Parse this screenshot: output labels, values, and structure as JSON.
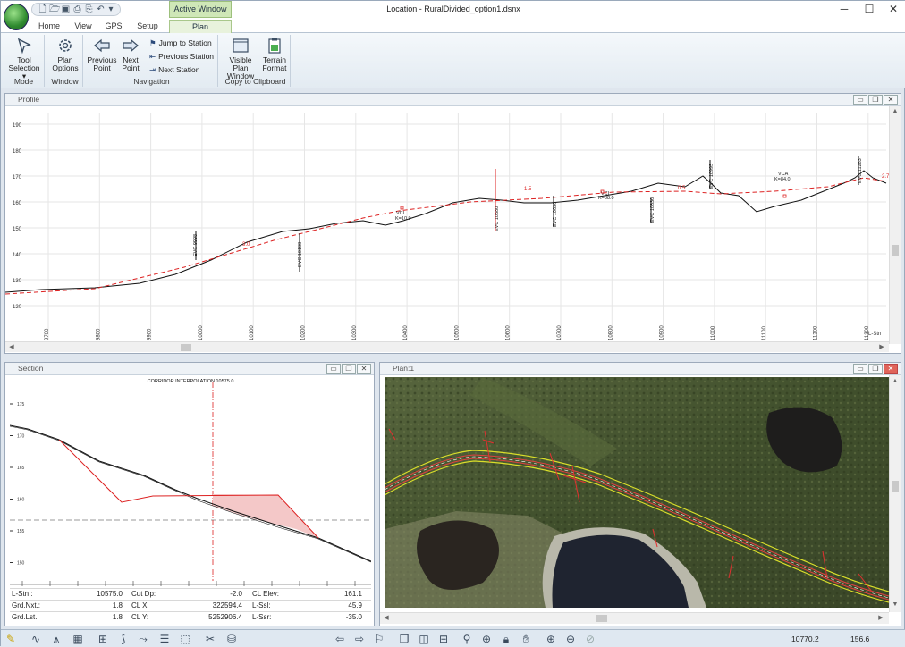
{
  "window": {
    "title": "Location - RuralDivided_option1.dsnx",
    "active_window_tab": "Active Window"
  },
  "tabs": [
    "Home",
    "View",
    "GPS",
    "Setup",
    "Plan"
  ],
  "ribbon": {
    "mode": {
      "label": "Mode",
      "tool_selection": "Tool Selection"
    },
    "window": {
      "label": "Window",
      "plan_options": "Plan Options"
    },
    "navigation": {
      "label": "Navigation",
      "previous_point": "Previous Point",
      "next_point": "Next Point",
      "jump_to_station": "Jump to Station",
      "previous_station": "Previous Station",
      "next_station": "Next Station"
    },
    "clipboard": {
      "label": "Copy to Clipboard",
      "visible_plan_window": "Visible Plan Window",
      "terrain_format": "Terrain Format"
    }
  },
  "profile": {
    "title": "Profile",
    "y_ticks": [
      "190",
      "180",
      "170",
      "160",
      "150",
      "140",
      "130",
      "120"
    ],
    "x_ticks": [
      "9700",
      "9800",
      "9900",
      "10000",
      "10100",
      "10200",
      "10300",
      "10400",
      "10500",
      "10600",
      "10700",
      "10800",
      "10900",
      "11000",
      "11100",
      "11200",
      "11300"
    ],
    "x_unit": "L-Stn",
    "labels": {
      "evc1": "EVC 9998",
      "evc2": "EVC 10188",
      "vc1": "VCL",
      "vc1b": "K=10.9",
      "evc3": "EVC 10580",
      "evc4": "EVC 10636",
      "vc2": "VCL",
      "vc2b": "K=88.0",
      "evc5": "EVC 10830",
      "evc6": "EVC 10995",
      "vc3": "VCA",
      "vc3b": "K=84.0",
      "evc7": "EVC 11283",
      "g1": "3.0",
      "g2": "1.5",
      "g3": "0.5",
      "g4": "2.7"
    }
  },
  "section": {
    "title": "Section",
    "heading": "CORRIDOR INTERPOLATION 10575.0",
    "y_ticks": [
      "175",
      "170",
      "165",
      "160",
      "155",
      "150"
    ],
    "rows": [
      [
        {
          "k": "L-Stn :",
          "v": "10575.0"
        },
        {
          "k": "Cut Dp:",
          "v": "-2.0"
        },
        {
          "k": "CL Elev:",
          "v": "161.1"
        }
      ],
      [
        {
          "k": "Grd.Nxt.:",
          "v": "1.8"
        },
        {
          "k": "CL X:",
          "v": "322594.4"
        },
        {
          "k": "L-Ssl:",
          "v": "45.9"
        }
      ],
      [
        {
          "k": "Grd.Lst.:",
          "v": "1.8"
        },
        {
          "k": "CL Y:",
          "v": "5252906.4"
        },
        {
          "k": "L-Ssr:",
          "v": "-35.0"
        }
      ]
    ]
  },
  "plan": {
    "title": "Plan:1"
  },
  "status": {
    "station": "10770.2",
    "elevation": "156.6"
  }
}
